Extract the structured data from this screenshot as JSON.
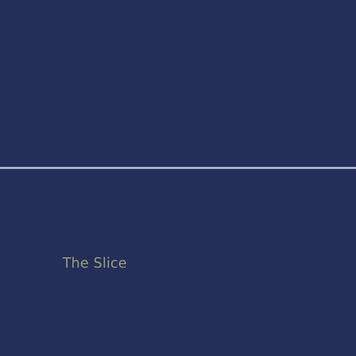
{
  "page": {
    "title": "The Slice"
  },
  "colors": {
    "background": "#232f58",
    "divider": "#b7b3d6",
    "title_text": "#9a9a82"
  }
}
